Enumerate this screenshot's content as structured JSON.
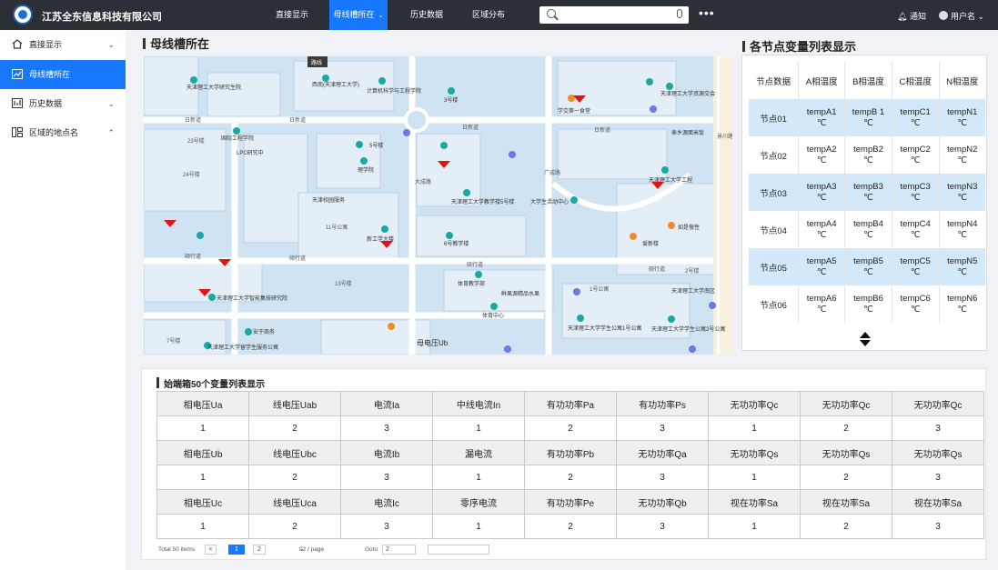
{
  "header": {
    "company": "江苏全东信息科技有限公司",
    "nav": [
      {
        "label": "直接显示"
      },
      {
        "label": "母线槽所在"
      },
      {
        "label": "历史数据"
      },
      {
        "label": "区域分布"
      }
    ],
    "search_placeholder": "",
    "more": "•••",
    "notify": "通知",
    "user": "用户名 ⌄"
  },
  "sidebar": {
    "items": [
      {
        "label": "直接显示",
        "icon": "home-icon"
      },
      {
        "label": "母线槽所在",
        "icon": "line-chart-icon"
      },
      {
        "label": "历史数据",
        "icon": "history-icon"
      },
      {
        "label": "区域的地点名",
        "icon": "grid-icon"
      }
    ]
  },
  "map_panel": {
    "title": "母线槽所在",
    "labels": {
      "top_badge": "路线",
      "l1": "天津理工大学研究生院",
      "l2": "西南(天津理工大学)",
      "l3": "计算机科学与工程学院",
      "l4": "3号楼",
      "l5": "天津理工大学资源交会",
      "l6": "学交第一食堂",
      "l7": "国际工程学院",
      "l8": "LPC研究中",
      "l9": "5号楼",
      "l10": "理学院",
      "l11": "天津理工大学教学楼5号楼",
      "l12": "大学生活动中心",
      "l13": "天津理工大学工程",
      "l14": "天津校园服务",
      "l15": "如是慢性",
      "l16": "爱新楼",
      "l17": "6号教学楼",
      "l18": "新工学大楼",
      "l19": "天津理工大学智能集技研究院",
      "l20": "体育教学部",
      "l21": "鲜果源精品水果",
      "l22": "天津理工大学学生公寓1号公寓",
      "l23": "天津理工大学学生公寓2号公寓",
      "l24": "天津理工大学南区",
      "l25": "天津理工大学留学生服务公寓",
      "l26": "奉乡源面米饭",
      "l27": "母电压Ub",
      "l28": "安于商务",
      "l29": "体育中心",
      "road1": "日新道",
      "road2": "硕行道",
      "road3": "大成路",
      "road4": "景川路",
      "road5": "广成路",
      "b1": "23号楼",
      "b2": "24号楼",
      "b3": "13号楼",
      "b4": "11号公寓",
      "b5": "2号楼",
      "b6": "7号楼",
      "b7": "1号公寓"
    }
  },
  "nodes": {
    "title": "各节点变量列表显示",
    "headers": [
      "节点数据",
      "A相温度",
      "B相温度",
      "C相温度",
      "N相温度"
    ],
    "rows": [
      {
        "name": "节点01",
        "a": "tempA1",
        "b": "tempB 1",
        "c": "tempC1",
        "n": "tempN1"
      },
      {
        "name": "节点02",
        "a": "tempA2",
        "b": "tempB2",
        "c": "tempC2",
        "n": "tempN2"
      },
      {
        "name": "节点03",
        "a": "tempA3",
        "b": "tempB3",
        "c": "tempC3",
        "n": "tempN3"
      },
      {
        "name": "节点04",
        "a": "tempA4",
        "b": "tempB4",
        "c": "tempC4",
        "n": "tempN4"
      },
      {
        "name": "节点05",
        "a": "tempA5",
        "b": "tempB5",
        "c": "tempC5",
        "n": "tempN5"
      },
      {
        "name": "节点06",
        "a": "tempA6",
        "b": "tempB6",
        "c": "tempC6",
        "n": "tempN6"
      }
    ],
    "unit": "℃"
  },
  "terminal": {
    "title": "始端箱50个变量列表显示",
    "rows": [
      {
        "labels": [
          "相电压Ua",
          "线电压Uab",
          "电流Ia",
          "中线电流In",
          "有功功率Pa",
          "有功功率Ps",
          "无功功率Qc",
          "无功功率Qc",
          "无功功率Qc"
        ],
        "values": [
          "1",
          "2",
          "3",
          "1",
          "2",
          "3",
          "1",
          "2",
          "3"
        ]
      },
      {
        "labels": [
          "相电压Ub",
          "线电压Ubc",
          "电流Ib",
          "漏电流",
          "有功功率Pb",
          "无功功率Qa",
          "无功功率Qs",
          "无功功率Qs",
          "无功功率Qs"
        ],
        "values": [
          "1",
          "2",
          "3",
          "1",
          "2",
          "3",
          "1",
          "2",
          "3"
        ]
      },
      {
        "labels": [
          "相电压Uc",
          "线电压Uca",
          "电流Ic",
          "零序电流",
          "有功功率Pe",
          "无功功率Qb",
          "视在功率Sa",
          "视在功率Sa",
          "视在功率Sa"
        ],
        "values": [
          "1",
          "2",
          "3",
          "1",
          "2",
          "3",
          "1",
          "2",
          "3"
        ]
      }
    ]
  },
  "pagination": {
    "total": "Total 50 items",
    "prev": "<",
    "pages": [
      "1",
      "2"
    ],
    "per_page": "02 / page",
    "goto_label": "Goto",
    "goto_value": "2"
  }
}
